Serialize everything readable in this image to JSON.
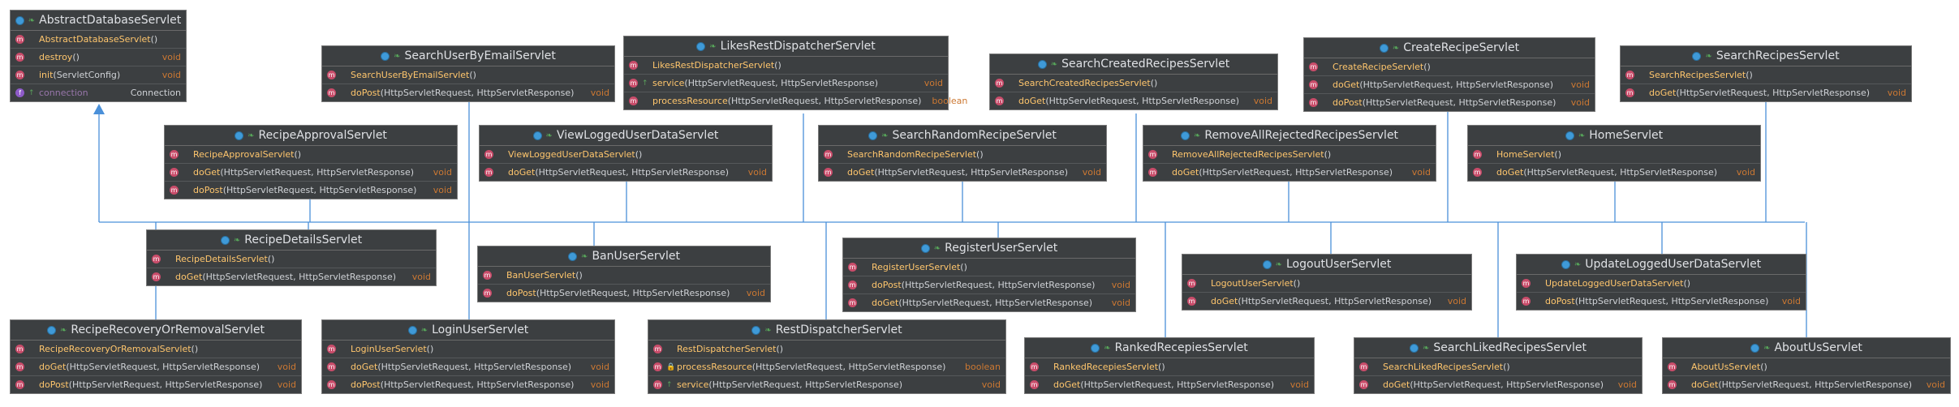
{
  "colors": {
    "edge": "#4a90d9",
    "panel": "#3c3f41",
    "method": "#ffc66d",
    "return_type": "#cc7832",
    "field": "#9876aa"
  },
  "classes": {
    "abstract_db": {
      "title": "AbstractDatabaseServlet",
      "members": [
        {
          "kind": "method",
          "icon_letter": "m",
          "vis": "",
          "name": "AbstractDatabaseServlet",
          "args": "()",
          "ret": ""
        },
        {
          "kind": "method",
          "icon_letter": "m",
          "vis": "",
          "name": "destroy",
          "args": "()",
          "ret": "void"
        },
        {
          "kind": "method",
          "icon_letter": "m",
          "vis": "",
          "name": "init",
          "args": "(ServletConfig)",
          "ret": "void"
        },
        {
          "kind": "field",
          "icon_letter": "f",
          "vis": "↑",
          "name": "connection",
          "args": "",
          "ret": "Connection"
        }
      ]
    },
    "search_user_email": {
      "title": "SearchUserByEmailServlet",
      "members": [
        {
          "kind": "method",
          "icon_letter": "m",
          "vis": "",
          "name": "SearchUserByEmailServlet",
          "args": "()",
          "ret": ""
        },
        {
          "kind": "method",
          "icon_letter": "m",
          "vis": "",
          "name": "doPost",
          "args": "(HttpServletRequest, HttpServletResponse)",
          "ret": "void"
        }
      ]
    },
    "likes_rest": {
      "title": "LikesRestDispatcherServlet",
      "members": [
        {
          "kind": "method",
          "icon_letter": "m",
          "vis": "",
          "name": "LikesRestDispatcherServlet",
          "args": "()",
          "ret": ""
        },
        {
          "kind": "method",
          "icon_letter": "m",
          "vis": "↑",
          "name": "service",
          "args": "(HttpServletRequest, HttpServletResponse)",
          "ret": "void"
        },
        {
          "kind": "method",
          "icon_letter": "m",
          "vis": "",
          "name": "processResource",
          "args": "(HttpServletRequest, HttpServletResponse)",
          "ret": "boolean"
        }
      ]
    },
    "search_created": {
      "title": "SearchCreatedRecipesServlet",
      "members": [
        {
          "kind": "method",
          "icon_letter": "m",
          "vis": "",
          "name": "SearchCreatedRecipesServlet",
          "args": "()",
          "ret": ""
        },
        {
          "kind": "method",
          "icon_letter": "m",
          "vis": "",
          "name": "doGet",
          "args": "(HttpServletRequest, HttpServletResponse)",
          "ret": "void"
        }
      ]
    },
    "create_recipe": {
      "title": "CreateRecipeServlet",
      "members": [
        {
          "kind": "method",
          "icon_letter": "m",
          "vis": "",
          "name": "CreateRecipeServlet",
          "args": "()",
          "ret": ""
        },
        {
          "kind": "method",
          "icon_letter": "m",
          "vis": "",
          "name": "doGet",
          "args": "(HttpServletRequest, HttpServletResponse)",
          "ret": "void"
        },
        {
          "kind": "method",
          "icon_letter": "m",
          "vis": "",
          "name": "doPost",
          "args": "(HttpServletRequest, HttpServletResponse)",
          "ret": "void"
        }
      ]
    },
    "search_recipes": {
      "title": "SearchRecipesServlet",
      "members": [
        {
          "kind": "method",
          "icon_letter": "m",
          "vis": "",
          "name": "SearchRecipesServlet",
          "args": "()",
          "ret": ""
        },
        {
          "kind": "method",
          "icon_letter": "m",
          "vis": "",
          "name": "doGet",
          "args": "(HttpServletRequest, HttpServletResponse)",
          "ret": "void"
        }
      ]
    },
    "recipe_approval": {
      "title": "RecipeApprovalServlet",
      "members": [
        {
          "kind": "method",
          "icon_letter": "m",
          "vis": "",
          "name": "RecipeApprovalServlet",
          "args": "()",
          "ret": ""
        },
        {
          "kind": "method",
          "icon_letter": "m",
          "vis": "",
          "name": "doGet",
          "args": "(HttpServletRequest, HttpServletResponse)",
          "ret": "void"
        },
        {
          "kind": "method",
          "icon_letter": "m",
          "vis": "",
          "name": "doPost",
          "args": "(HttpServletRequest, HttpServletResponse)",
          "ret": "void"
        }
      ]
    },
    "view_logged_user": {
      "title": "ViewLoggedUserDataServlet",
      "members": [
        {
          "kind": "method",
          "icon_letter": "m",
          "vis": "",
          "name": "ViewLoggedUserDataServlet",
          "args": "()",
          "ret": ""
        },
        {
          "kind": "method",
          "icon_letter": "m",
          "vis": "",
          "name": "doGet",
          "args": "(HttpServletRequest, HttpServletResponse)",
          "ret": "void"
        }
      ]
    },
    "search_random": {
      "title": "SearchRandomRecipeServlet",
      "members": [
        {
          "kind": "method",
          "icon_letter": "m",
          "vis": "",
          "name": "SearchRandomRecipeServlet",
          "args": "()",
          "ret": ""
        },
        {
          "kind": "method",
          "icon_letter": "m",
          "vis": "",
          "name": "doGet",
          "args": "(HttpServletRequest, HttpServletResponse)",
          "ret": "void"
        }
      ]
    },
    "remove_rejected": {
      "title": "RemoveAllRejectedRecipesServlet",
      "members": [
        {
          "kind": "method",
          "icon_letter": "m",
          "vis": "",
          "name": "RemoveAllRejectedRecipesServlet",
          "args": "()",
          "ret": ""
        },
        {
          "kind": "method",
          "icon_letter": "m",
          "vis": "",
          "name": "doGet",
          "args": "(HttpServletRequest, HttpServletResponse)",
          "ret": "void"
        }
      ]
    },
    "home": {
      "title": "HomeServlet",
      "members": [
        {
          "kind": "method",
          "icon_letter": "m",
          "vis": "",
          "name": "HomeServlet",
          "args": "()",
          "ret": ""
        },
        {
          "kind": "method",
          "icon_letter": "m",
          "vis": "",
          "name": "doGet",
          "args": "(HttpServletRequest, HttpServletResponse)",
          "ret": "void"
        }
      ]
    },
    "recipe_details": {
      "title": "RecipeDetailsServlet",
      "members": [
        {
          "kind": "method",
          "icon_letter": "m",
          "vis": "",
          "name": "RecipeDetailsServlet",
          "args": "()",
          "ret": ""
        },
        {
          "kind": "method",
          "icon_letter": "m",
          "vis": "",
          "name": "doGet",
          "args": "(HttpServletRequest, HttpServletResponse)",
          "ret": "void"
        }
      ]
    },
    "ban_user": {
      "title": "BanUserServlet",
      "members": [
        {
          "kind": "method",
          "icon_letter": "m",
          "vis": "",
          "name": "BanUserServlet",
          "args": "()",
          "ret": ""
        },
        {
          "kind": "method",
          "icon_letter": "m",
          "vis": "",
          "name": "doPost",
          "args": "(HttpServletRequest, HttpServletResponse)",
          "ret": "void"
        }
      ]
    },
    "register_user": {
      "title": "RegisterUserServlet",
      "members": [
        {
          "kind": "method",
          "icon_letter": "m",
          "vis": "",
          "name": "RegisterUserServlet",
          "args": "()",
          "ret": ""
        },
        {
          "kind": "method",
          "icon_letter": "m",
          "vis": "",
          "name": "doPost",
          "args": "(HttpServletRequest, HttpServletResponse)",
          "ret": "void"
        },
        {
          "kind": "method",
          "icon_letter": "m",
          "vis": "",
          "name": "doGet",
          "args": "(HttpServletRequest, HttpServletResponse)",
          "ret": "void"
        }
      ]
    },
    "logout_user": {
      "title": "LogoutUserServlet",
      "members": [
        {
          "kind": "method",
          "icon_letter": "m",
          "vis": "",
          "name": "LogoutUserServlet",
          "args": "()",
          "ret": ""
        },
        {
          "kind": "method",
          "icon_letter": "m",
          "vis": "",
          "name": "doGet",
          "args": "(HttpServletRequest, HttpServletResponse)",
          "ret": "void"
        }
      ]
    },
    "update_logged_user": {
      "title": "UpdateLoggedUserDataServlet",
      "members": [
        {
          "kind": "method",
          "icon_letter": "m",
          "vis": "",
          "name": "UpdateLoggedUserDataServlet",
          "args": "()",
          "ret": ""
        },
        {
          "kind": "method",
          "icon_letter": "m",
          "vis": "",
          "name": "doPost",
          "args": "(HttpServletRequest, HttpServletResponse)",
          "ret": "void"
        }
      ]
    },
    "recipe_recovery": {
      "title": "RecipeRecoveryOrRemovalServlet",
      "members": [
        {
          "kind": "method",
          "icon_letter": "m",
          "vis": "",
          "name": "RecipeRecoveryOrRemovalServlet",
          "args": "()",
          "ret": ""
        },
        {
          "kind": "method",
          "icon_letter": "m",
          "vis": "",
          "name": "doGet",
          "args": "(HttpServletRequest, HttpServletResponse)",
          "ret": "void"
        },
        {
          "kind": "method",
          "icon_letter": "m",
          "vis": "",
          "name": "doPost",
          "args": "(HttpServletRequest, HttpServletResponse)",
          "ret": "void"
        }
      ]
    },
    "login_user": {
      "title": "LoginUserServlet",
      "members": [
        {
          "kind": "method",
          "icon_letter": "m",
          "vis": "",
          "name": "LoginUserServlet",
          "args": "()",
          "ret": ""
        },
        {
          "kind": "method",
          "icon_letter": "m",
          "vis": "",
          "name": "doGet",
          "args": "(HttpServletRequest, HttpServletResponse)",
          "ret": "void"
        },
        {
          "kind": "method",
          "icon_letter": "m",
          "vis": "",
          "name": "doPost",
          "args": "(HttpServletRequest, HttpServletResponse)",
          "ret": "void"
        }
      ]
    },
    "rest_dispatcher": {
      "title": "RestDispatcherServlet",
      "members": [
        {
          "kind": "method",
          "icon_letter": "m",
          "vis": "",
          "name": "RestDispatcherServlet",
          "args": "()",
          "ret": ""
        },
        {
          "kind": "method",
          "icon_letter": "m",
          "vis": "🔒",
          "name": "processResource",
          "args": "(HttpServletRequest, HttpServletResponse)",
          "ret": "boolean"
        },
        {
          "kind": "method",
          "icon_letter": "m",
          "vis": "↑",
          "name": "service",
          "args": "(HttpServletRequest, HttpServletResponse)",
          "ret": "void"
        }
      ]
    },
    "ranked_recipes": {
      "title": "RankedRecepiesServlet",
      "members": [
        {
          "kind": "method",
          "icon_letter": "m",
          "vis": "",
          "name": "RankedRecepiesServlet",
          "args": "()",
          "ret": ""
        },
        {
          "kind": "method",
          "icon_letter": "m",
          "vis": "",
          "name": "doGet",
          "args": "(HttpServletRequest, HttpServletResponse)",
          "ret": "void"
        }
      ]
    },
    "search_liked": {
      "title": "SearchLikedRecipesServlet",
      "members": [
        {
          "kind": "method",
          "icon_letter": "m",
          "vis": "",
          "name": "SearchLikedRecipesServlet",
          "args": "()",
          "ret": ""
        },
        {
          "kind": "method",
          "icon_letter": "m",
          "vis": "",
          "name": "doGet",
          "args": "(HttpServletRequest, HttpServletResponse)",
          "ret": "void"
        }
      ]
    },
    "about_us": {
      "title": "AboutUsServlet",
      "members": [
        {
          "kind": "method",
          "icon_letter": "m",
          "vis": "",
          "name": "AboutUsServlet",
          "args": "()",
          "ret": ""
        },
        {
          "kind": "method",
          "icon_letter": "m",
          "vis": "",
          "name": "doGet",
          "args": "(HttpServletRequest, HttpServletResponse)",
          "ret": "void"
        }
      ]
    }
  }
}
